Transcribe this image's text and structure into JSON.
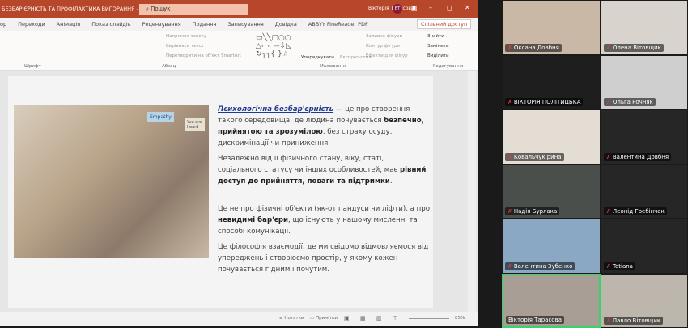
{
  "window": {
    "title": "БЕЗБАР'ЄРНІСТЬ ТА ПРОФІЛАКТИКА ВИГОРАННЯ - PowerPoint",
    "search_placeholder": "Пошук",
    "user": "Вікторія Тарасова",
    "user_initials": "ВТ"
  },
  "tabs": [
    "ор",
    "Переходи",
    "Анімація",
    "Показ слайдів",
    "Рецензування",
    "Подання",
    "Записування",
    "Довідка",
    "ABBYY FineReader PDF"
  ],
  "share_label": "Спільний доступ",
  "ribbon": {
    "groups": [
      "Шрифт",
      "Абзац",
      "Малювання",
      "Редагування"
    ],
    "items": [
      "Напрямок тексту",
      "Вирівняти текст",
      "Перетворити на об'єкт SmartArt",
      "Упорядкувати",
      "Експрес-стилі",
      "Заливка фігури",
      "Контур фігури",
      "Ефекти для фігур",
      "Знайти",
      "Замінити",
      "Виділити"
    ]
  },
  "slide": {
    "p1": {
      "em": "Психологічна безбар'єрність",
      "t1": " — це про створення такого середовища, де людина почувається ",
      "b1": "безпечно, прийнятою та зрозумілою",
      "t2": ", без страху осуду, дискримінації чи приниження."
    },
    "p2": {
      "t1": "Незалежно від її фізичного стану, віку, статі, соціального статусу чи інших особливостей, має ",
      "b1": "рівний доступ до прийняття, поваги та підтримки",
      "t2": "."
    },
    "p3": {
      "t1": "Це не про фізичні об'єкти (як-от пандуси чи ліфти), а про ",
      "b1": "невидимі бар'єри",
      "t2": ", що існують у нашому мисленні та способі комунікації."
    },
    "p4": "Це філософія взаємодії, де ми свідомо відмовляємося від упереджень і створюємо простір, у якому кожен почувається гідним і почутим.",
    "photo_signs": [
      "Empathy",
      "You are heard"
    ]
  },
  "status": {
    "notes": "Нотатки",
    "comments": "Примітки",
    "zoom": "85%"
  },
  "participants": [
    {
      "name": "Оксана Довбня",
      "muted": true,
      "bg": "#c9b8a6"
    },
    {
      "name": "Олена Вітовщик",
      "muted": true,
      "bg": "#d8d3cc"
    },
    {
      "name": "ВІКТОРІЯ ПОЛІТИЦЬКА",
      "muted": true,
      "bg": "#1e1e1e"
    },
    {
      "name": "Ольга Рочняк",
      "muted": true,
      "bg": "#cfcfcf"
    },
    {
      "name": "КовальчукІрина",
      "muted": true,
      "bg": "#e4ddd4"
    },
    {
      "name": "Валентина Довбня",
      "muted": true,
      "bg": "#262626"
    },
    {
      "name": "Надія Бурлака",
      "muted": true,
      "bg": "#4a4f4c"
    },
    {
      "name": "Леонід Гребінчак",
      "muted": true,
      "bg": "#262626"
    },
    {
      "name": "Валентина Зубенко",
      "muted": true,
      "bg": "#8aa7c4"
    },
    {
      "name": "Tetiana",
      "muted": true,
      "bg": "#262626"
    },
    {
      "name": "Вікторія Тарасова",
      "muted": false,
      "bg": "#a89e95",
      "active": true
    },
    {
      "name": "Павло Вітовщик",
      "muted": true,
      "bg": "#bdb6ad"
    }
  ]
}
